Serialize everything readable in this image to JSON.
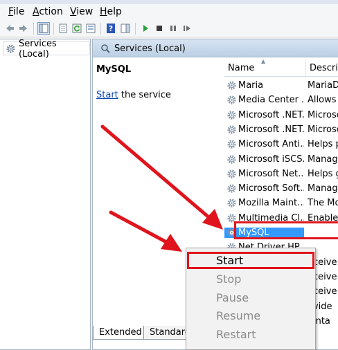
{
  "menu": [
    "File",
    "Action",
    "View",
    "Help"
  ],
  "menu_mnemonics": [
    "F",
    "A",
    "V",
    "H"
  ],
  "tree": {
    "item_label": "Services (Local)"
  },
  "pane": {
    "title": "Services (Local)",
    "selected_service": "MySQL",
    "start_link": "Start",
    "start_suffix": " the service"
  },
  "columns": {
    "name": "Name",
    "description": "Descrip"
  },
  "services": [
    {
      "name": "Maria",
      "desc": "MariaD"
    },
    {
      "name": "Media Center ...",
      "desc": "Allows"
    },
    {
      "name": "Microsoft .NET...",
      "desc": "Microso"
    },
    {
      "name": "Microsoft .NET...",
      "desc": "Microso"
    },
    {
      "name": "Microsoft Anti...",
      "desc": "Helps p"
    },
    {
      "name": "Microsoft iSCS...",
      "desc": "Manage"
    },
    {
      "name": "Microsoft Net...",
      "desc": "Helps g"
    },
    {
      "name": "Microsoft Soft...",
      "desc": "Manage"
    },
    {
      "name": "Mozilla Maint...",
      "desc": "The Mo"
    },
    {
      "name": "Multimedia Cl...",
      "desc": "Enables"
    },
    {
      "name": "MySQL",
      "desc": ""
    },
    {
      "name": "Net Driver HP...",
      "desc": ""
    },
    {
      "name": "",
      "desc": "eceive"
    },
    {
      "name": "",
      "desc": "eceive"
    },
    {
      "name": "",
      "desc": "eceive"
    },
    {
      "name": "",
      "desc": "ovide"
    },
    {
      "name": "",
      "desc": "ainta"
    }
  ],
  "selected_index": 10,
  "tabs": [
    "Extended",
    "Standard"
  ],
  "context_menu": {
    "items": [
      "Start",
      "Stop",
      "Pause",
      "Resume",
      "Restart"
    ],
    "enabled": [
      true,
      false,
      false,
      false,
      false
    ]
  },
  "colors": {
    "annotation": "#e0141c",
    "selection": "#3399ff",
    "link": "#0645ad"
  }
}
